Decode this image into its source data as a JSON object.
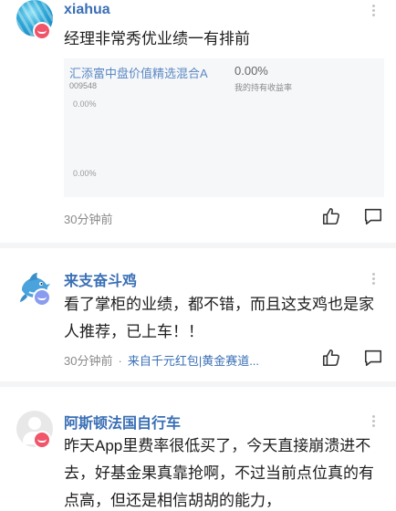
{
  "posts": [
    {
      "username": "xiahua",
      "content": "经理非常秀优业绩一有排前",
      "fund_card": {
        "name": "汇添富中盘价值精选混合A",
        "code": "009548",
        "return_value": "0.00%",
        "return_label": "我的持有收益率",
        "y_ticks": [
          "0.00%",
          "0.00%"
        ]
      },
      "time": "30分钟前"
    },
    {
      "username": "来支奋斗鸡",
      "content": "看了掌柜的业绩，都不错，而且这支鸡也是家人推荐，已上车！！",
      "time": "30分钟前",
      "separator": "·",
      "source": "来自千元红包|黄金赛道..."
    },
    {
      "username": "阿斯顿法国自行车",
      "content": "昨天App里费率很低买了，今天直接崩溃进不去，好基金果真靠抢啊，不过当前点位真的有点高，但还是相信胡胡的能力，"
    }
  ],
  "icons": {
    "like": "thumbs-up-icon",
    "comment": "comment-icon",
    "more": "more-vertical-icon",
    "badge": "smile-badge-icon"
  },
  "colors": {
    "username": "#3a6fb5",
    "badge_red": "#f0556a",
    "badge_blue": "#8a9cf0",
    "divider": "#f4f5f7",
    "card_bg": "#f6f7f9"
  }
}
